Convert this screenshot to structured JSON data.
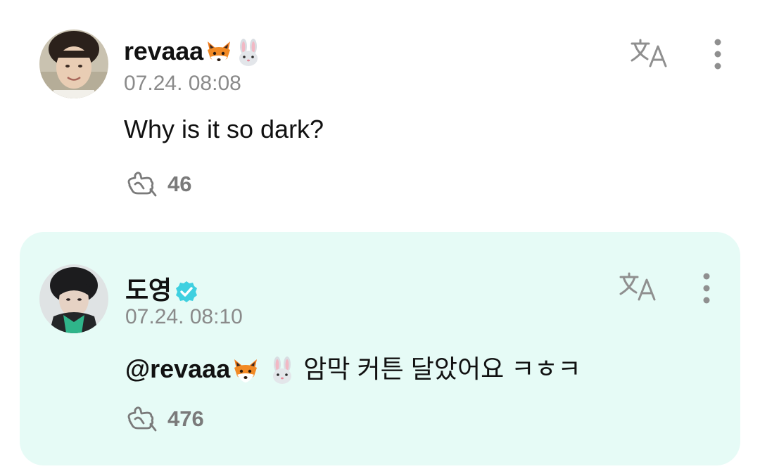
{
  "comments": [
    {
      "username": "revaaa",
      "username_emojis": [
        "fox-emoji",
        "rabbit-emoji"
      ],
      "timestamp": "07.24. 08:08",
      "text": "Why is it so dark?",
      "likes": "46",
      "verified": false
    },
    {
      "username": "도영",
      "verified": true,
      "timestamp": "07.24. 08:10",
      "mention": "@revaaa",
      "mention_emojis": [
        "fox-emoji",
        "rabbit-emoji"
      ],
      "text": "암막 커튼 달았어요 ㅋㅎㅋ",
      "likes": "476",
      "highlight_color": "#e6fbf6"
    }
  ],
  "icons": {
    "translate": "translate-icon",
    "more": "more-vertical-icon",
    "like": "like-hand-icon",
    "verified": "verified-badge-icon"
  },
  "colors": {
    "reply_background": "#e6fbf6",
    "verified_badge": "#3fd0e0",
    "timestamp": "#8a8a8a",
    "like_count": "#7a7a7a"
  }
}
